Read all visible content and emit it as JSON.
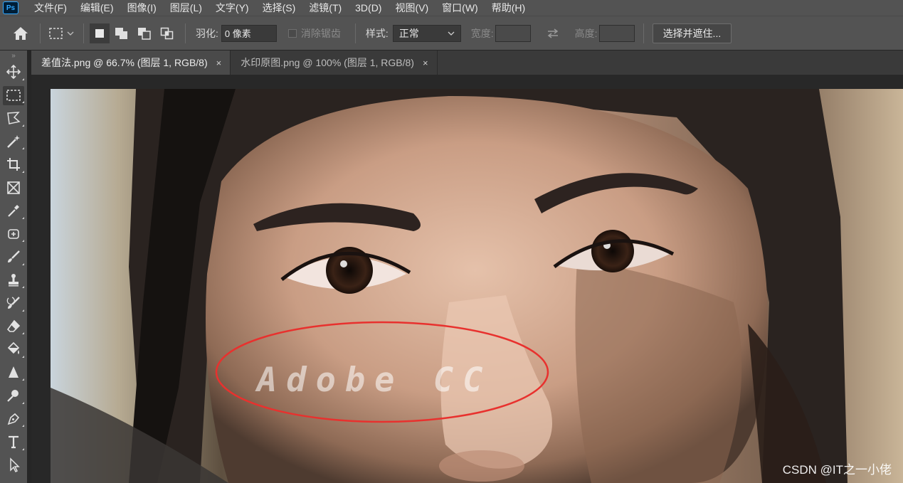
{
  "app": {
    "logo": "Ps"
  },
  "menu": [
    "文件(F)",
    "编辑(E)",
    "图像(I)",
    "图层(L)",
    "文字(Y)",
    "选择(S)",
    "滤镜(T)",
    "3D(D)",
    "视图(V)",
    "窗口(W)",
    "帮助(H)"
  ],
  "options": {
    "feather_label": "羽化:",
    "feather_value": "0 像素",
    "antialias_label": "消除锯齿",
    "style_label": "样式:",
    "style_value": "正常",
    "width_label": "宽度:",
    "height_label": "高度:",
    "select_mask_button": "选择并遮住..."
  },
  "tabs": [
    {
      "label": "差值法.png @ 66.7% (图层 1, RGB/8)",
      "close": "×",
      "active": true
    },
    {
      "label": "水印原图.png @ 100% (图层 1, RGB/8)",
      "close": "×",
      "active": false
    }
  ],
  "tools": [
    "move-tool",
    "rectangular-marquee-tool",
    "lasso-tool",
    "magic-wand-tool",
    "crop-tool",
    "frame-tool",
    "eyedropper-tool",
    "spot-healing-brush-tool",
    "brush-tool",
    "clone-stamp-tool",
    "history-brush-tool",
    "eraser-tool",
    "paint-bucket-tool",
    "blur-tool",
    "dodge-tool",
    "pen-tool",
    "type-tool",
    "path-selection-tool"
  ],
  "canvas": {
    "watermark_text": "Adobe CC",
    "annotation_color": "#e8312e",
    "credit": "CSDN @IT之一小佬"
  },
  "colors": {
    "accent": "#31a8ff",
    "ui_bg": "#535353",
    "panel_dark": "#3a3a3a",
    "annotation": "#e8312e"
  }
}
